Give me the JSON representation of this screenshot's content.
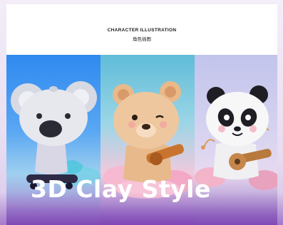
{
  "header": {
    "title": "CHARACTER ILLUSTRATION",
    "subtitle": "角色插图"
  },
  "panels": [
    {
      "character": "koala",
      "background": "#2f8af0"
    },
    {
      "character": "bear",
      "background": "#5fbcd8"
    },
    {
      "character": "panda",
      "background": "#c2c4ec"
    }
  ],
  "overlay": {
    "headline": "3D Clay Style",
    "color": "#ffffff"
  },
  "colors": {
    "accent_purple": "#8a5cbf",
    "blue": "#2f8af0",
    "teal": "#5fbcd8",
    "lavender": "#c2c4ec"
  }
}
